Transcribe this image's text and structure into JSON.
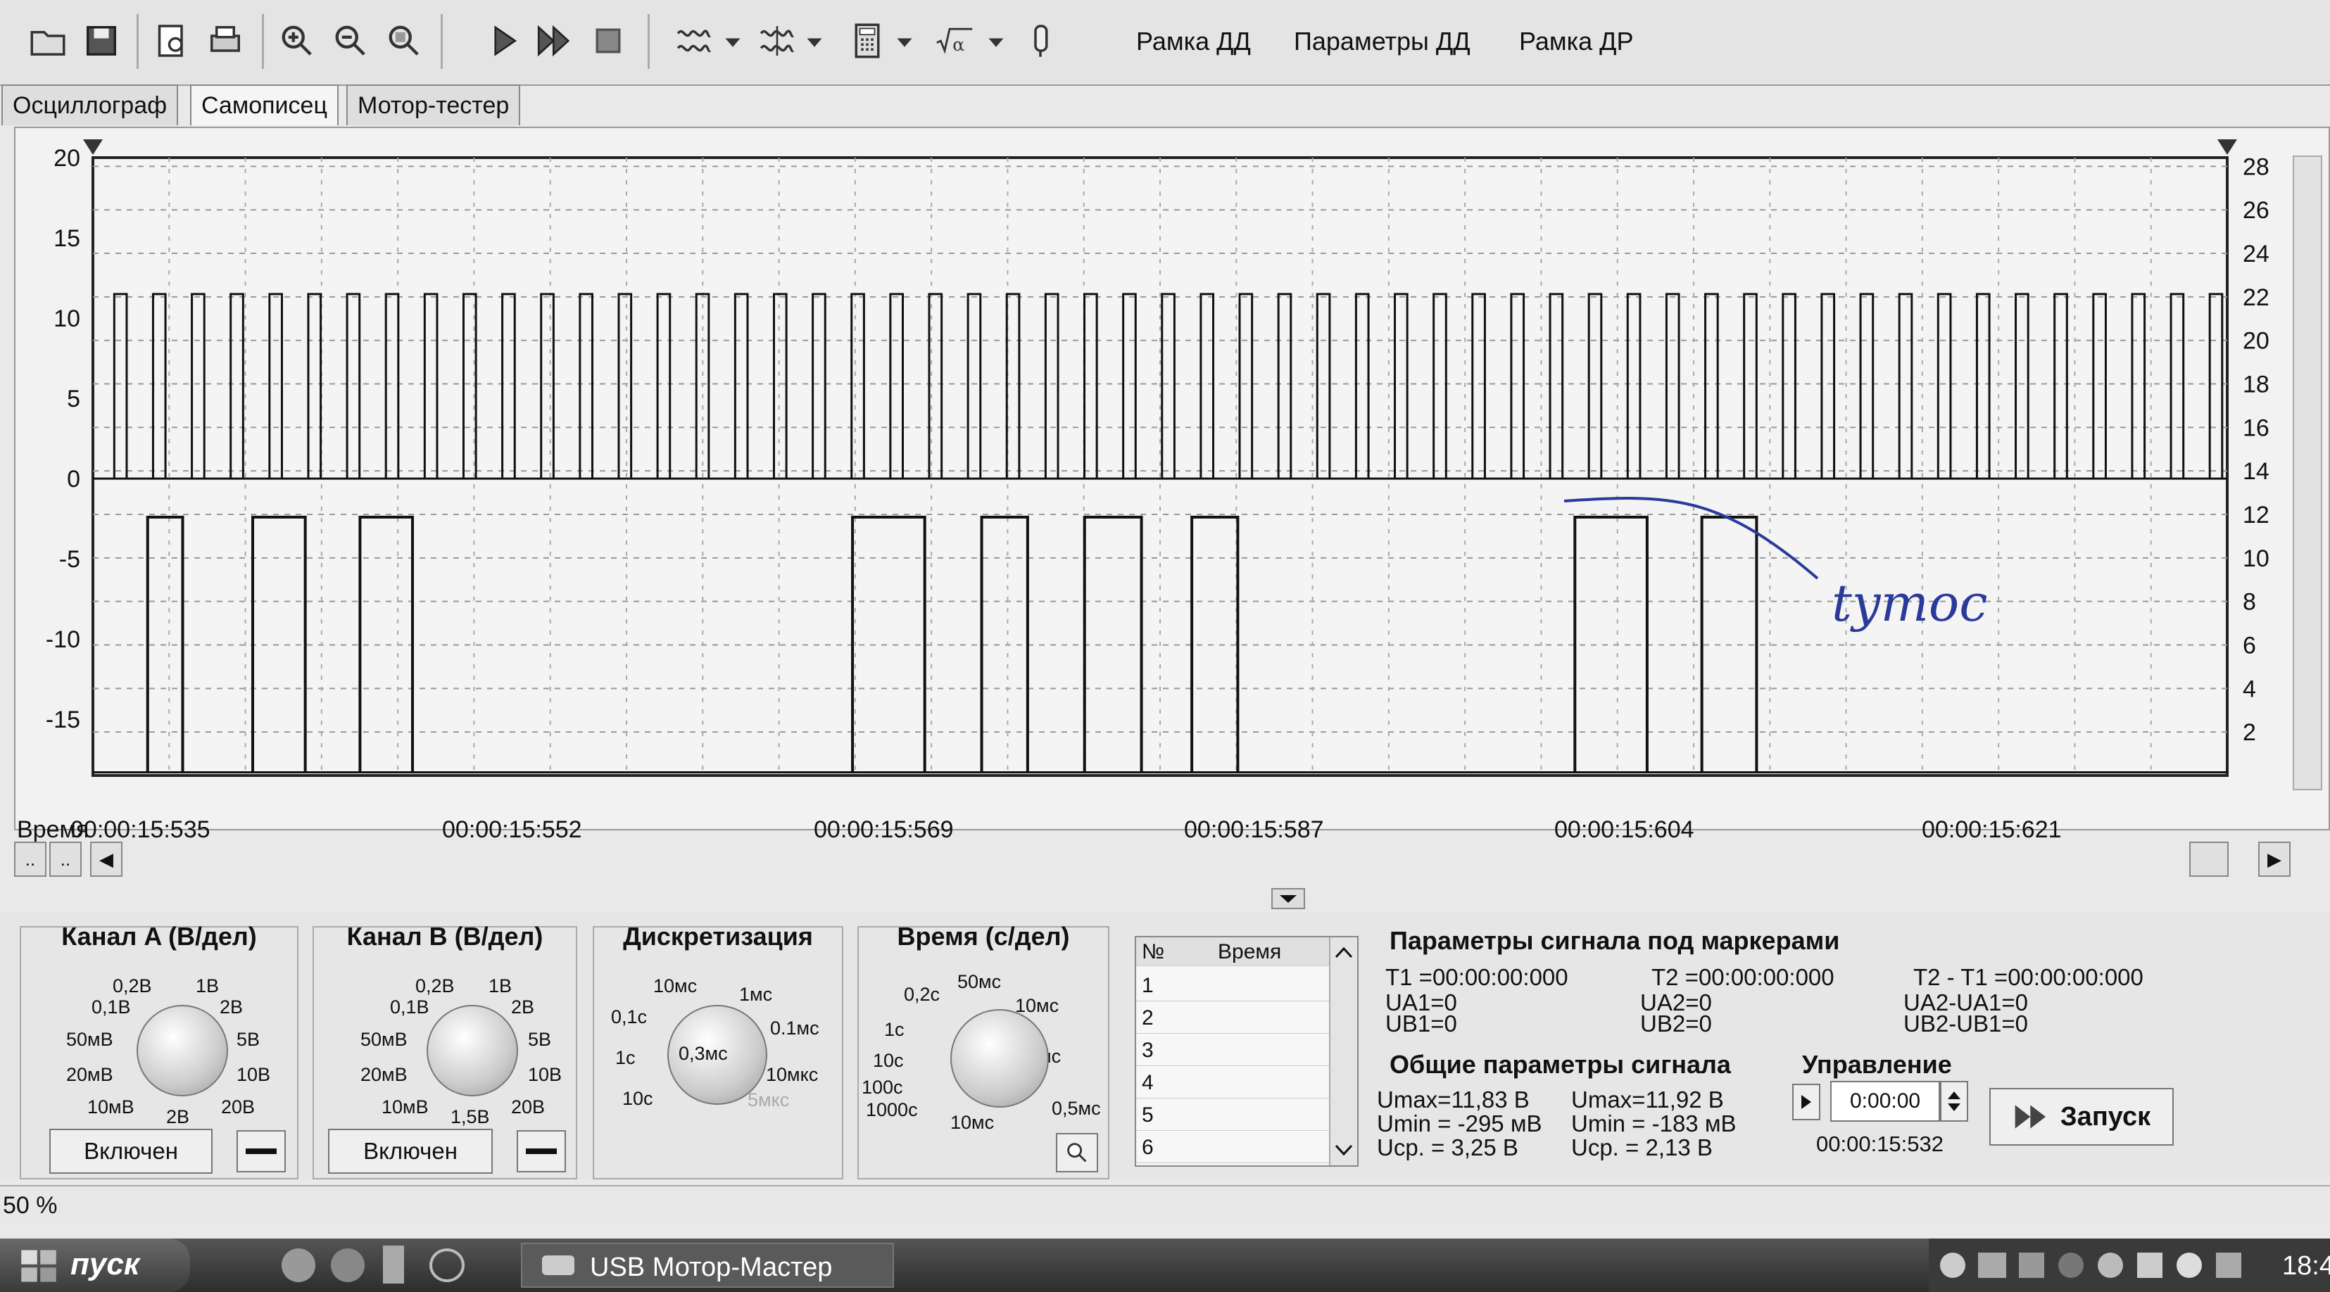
{
  "toolbar": {
    "icons": [
      "folder-open-icon",
      "save-icon",
      "print-preview-icon",
      "print-icon",
      "zoom-in-icon",
      "zoom-out-icon",
      "zoom-fit-icon",
      "play-icon",
      "fast-forward-icon",
      "stop-icon",
      "filter1-icon",
      "filter2-icon",
      "calculator-icon",
      "sqrt-icon",
      "probe-icon"
    ],
    "menu": [
      "Рамка ДД",
      "Параметры ДД",
      "Рамка ДР"
    ]
  },
  "tabs": [
    "Осциллограф",
    "Самописец",
    "Мотор-тестер"
  ],
  "active_tab": 1,
  "chart_data": {
    "type": "line",
    "left_axis": {
      "ticks": [
        20,
        15,
        10,
        5,
        0,
        -5,
        -10,
        -15
      ],
      "ylim": [
        -18.5,
        20
      ]
    },
    "right_axis": {
      "ticks": [
        28,
        26,
        24,
        22,
        20,
        18,
        16,
        14,
        12,
        10,
        8,
        6,
        4,
        2
      ],
      "ylim": [
        0,
        28.4
      ]
    },
    "x_labels": [
      "00:00:15:535",
      "00:00:15:552",
      "00:00:15:569",
      "00:00:15:587",
      "00:00:15:604",
      "00:00:15:621"
    ],
    "x_prefix": "Время",
    "xlim": [
      15.535,
      15.6325
    ],
    "series": [
      {
        "axis": "left",
        "low": 0,
        "high": 11.5,
        "pulse_count": 55
      },
      {
        "axis": "left",
        "low": -18.3,
        "high": -2.4,
        "pulses": [
          [
            15.5375,
            15.5391
          ],
          [
            15.5423,
            15.5447
          ],
          [
            15.5472,
            15.5496
          ],
          [
            15.5697,
            15.573
          ],
          [
            15.5756,
            15.5777
          ],
          [
            15.5803,
            15.5829
          ],
          [
            15.5852,
            15.5873
          ],
          [
            15.6027,
            15.606
          ],
          [
            15.6085,
            15.611
          ]
        ]
      }
    ],
    "annotation": "tymoc"
  },
  "scroll": {
    "left_buttons": [
      "..",
      ".."
    ],
    "left_arrow": "◀",
    "right_arrow": "▶"
  },
  "channel_a": {
    "title": "Канал A (В/дел)",
    "labels": [
      "0,2В",
      "1В",
      "0,1В",
      "2В",
      "50мВ",
      "5В",
      "20мВ",
      "10В",
      "10мВ",
      "2В",
      "20В"
    ],
    "enabled": "Включен"
  },
  "channel_b": {
    "title": "Канал B (В/дел)",
    "labels": [
      "0,2В",
      "1В",
      "0,1В",
      "2В",
      "50мВ",
      "5В",
      "20мВ",
      "10В",
      "10мВ",
      "1,5В",
      "20В"
    ],
    "enabled": "Включен"
  },
  "sampling": {
    "title": "Дискретизация",
    "labels": [
      "10мс",
      "1мс",
      "0,1с",
      "0.1мс",
      "1с",
      "10мкс",
      "10с",
      "5мкс"
    ],
    "value": "0,3мс"
  },
  "timebase": {
    "title": "Время (с/дел)",
    "labels": [
      "0,2с",
      "50мс",
      "10мс",
      "1с",
      "2мс",
      "10с",
      "100с",
      "0,5мс",
      "1000с",
      "10мс"
    ]
  },
  "marker_table": {
    "headers": [
      "№",
      "Время"
    ],
    "rows": [
      "1",
      "2",
      "3",
      "4",
      "5",
      "6"
    ]
  },
  "marker_params": {
    "title": "Параметры сигнала под маркерами",
    "t1": "T1 =00:00:00:000",
    "t2": "T2 =00:00:00:000",
    "dt": "T2 - T1 =00:00:00:000",
    "ua1": "UA1=0",
    "ub1": "UB1=0",
    "ua2": "UA2=0",
    "ub2": "UB2=0",
    "dua": "UA2-UA1=0",
    "dub": "UB2-UB1=0"
  },
  "general_params": {
    "title": "Общие параметры сигнала",
    "a_max": "Umax=11,83 В",
    "a_min": "Umin = -295 мВ",
    "a_avg": "Ucp. =  3,25 В",
    "b_max": "Umax=11,92 В",
    "b_min": "Umin = -183 мВ",
    "b_avg": "Ucp. =  2,13 В"
  },
  "control": {
    "title": "Управление",
    "time_value": "0:00:00",
    "current_time": "00:00:15:532",
    "start_label": "Запуск"
  },
  "status": {
    "zoom": "50 %"
  },
  "taskbar": {
    "start": "пуск",
    "app": "USB Мотор-Мастер",
    "clock": "18:4"
  }
}
